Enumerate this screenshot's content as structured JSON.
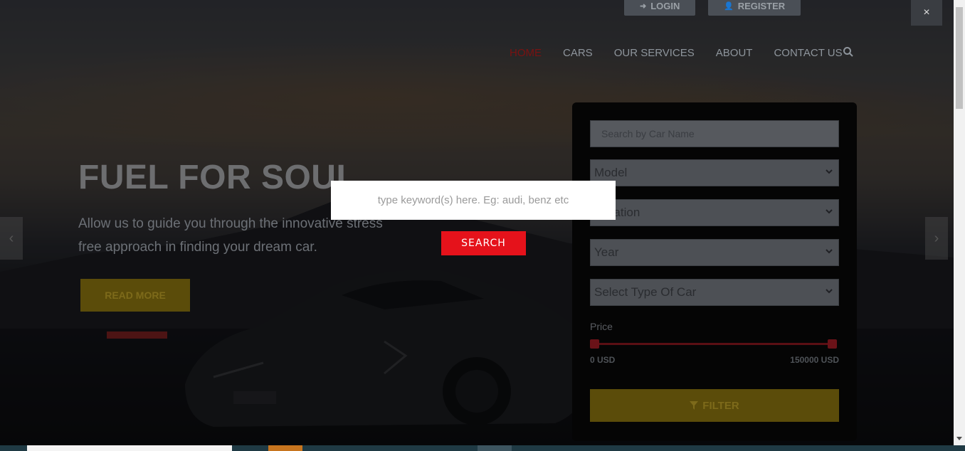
{
  "header": {
    "login_label": "LOGIN",
    "register_label": "REGISTER",
    "nav": [
      "HOME",
      "CARS",
      "OUR SERVICES",
      "ABOUT",
      "CONTACT US"
    ]
  },
  "hero": {
    "title": "FUEL FOR SOUL",
    "subtitle": "Allow us to guide you through the innovative stress free approach in finding your dream car.",
    "read_more": "READ MORE"
  },
  "filter": {
    "search_placeholder": "Search by Car Name",
    "model": "Model",
    "location": "Location",
    "year": "Year",
    "type": "Select Type Of Car",
    "price_label": "Price",
    "price_min": "0 USD",
    "price_max": "150000 USD",
    "filter_label": "FILTER"
  },
  "modal": {
    "placeholder": "type keyword(s) here. Eg: audi, benz etc",
    "search_label": "SEARCH",
    "close_label": "×"
  },
  "colors": {
    "accent_red": "#e5121b",
    "accent_yellow": "#f0c800"
  }
}
